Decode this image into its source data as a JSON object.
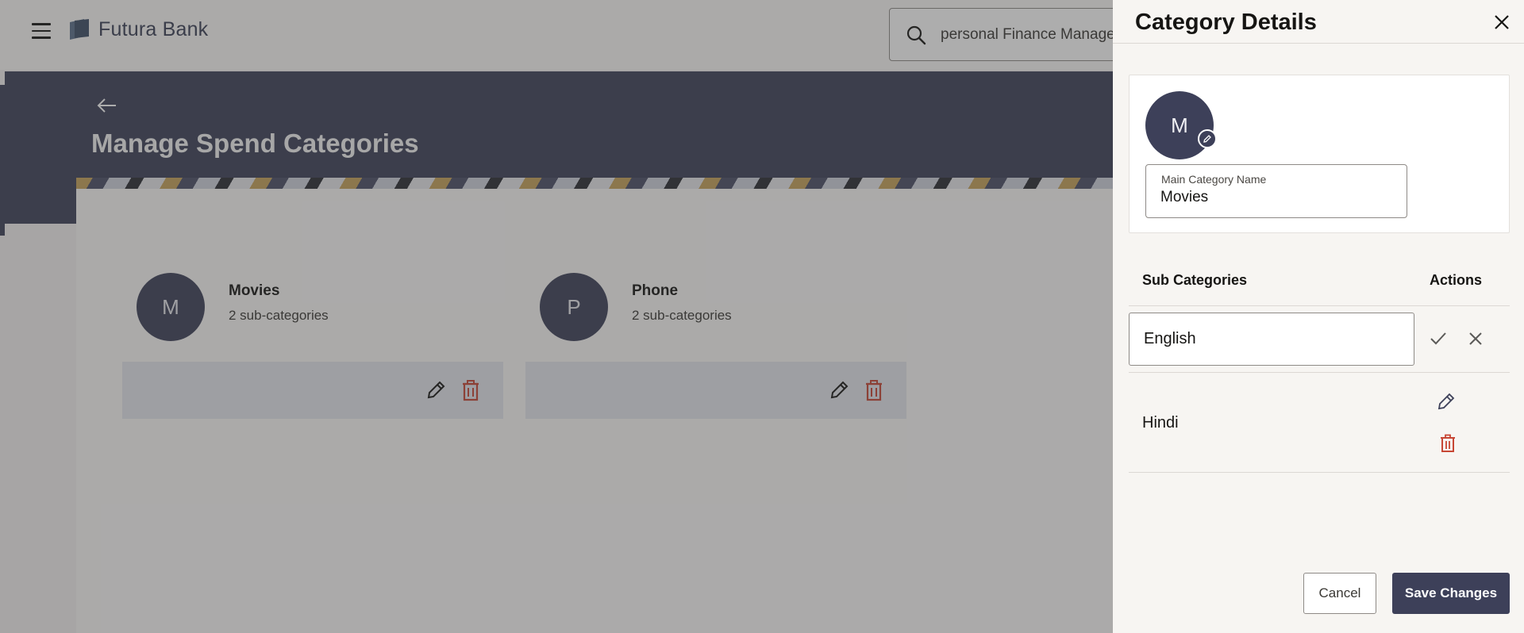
{
  "header": {
    "brand": "Futura Bank",
    "search_value": "personal Finance Manage"
  },
  "page": {
    "title": "Manage Spend Categories"
  },
  "categories": [
    {
      "initial": "M",
      "name": "Movies",
      "subtitle": "2 sub-categories"
    },
    {
      "initial": "P",
      "name": "Phone",
      "subtitle": "2 sub-categories"
    }
  ],
  "panel": {
    "title": "Category Details",
    "avatar_initial": "M",
    "main_category_label": "Main Category Name",
    "main_category_value": "Movies",
    "sub_header": "Sub Categories",
    "actions_header": "Actions",
    "sub_categories": [
      {
        "name": "English",
        "editing": true
      },
      {
        "name": "Hindi",
        "editing": false
      }
    ],
    "cancel_label": "Cancel",
    "save_label": "Save Changes"
  },
  "colors": {
    "brand": "#3d4059",
    "delete": "#c74634",
    "overlay": "rgba(60,60,60,0.42)"
  }
}
